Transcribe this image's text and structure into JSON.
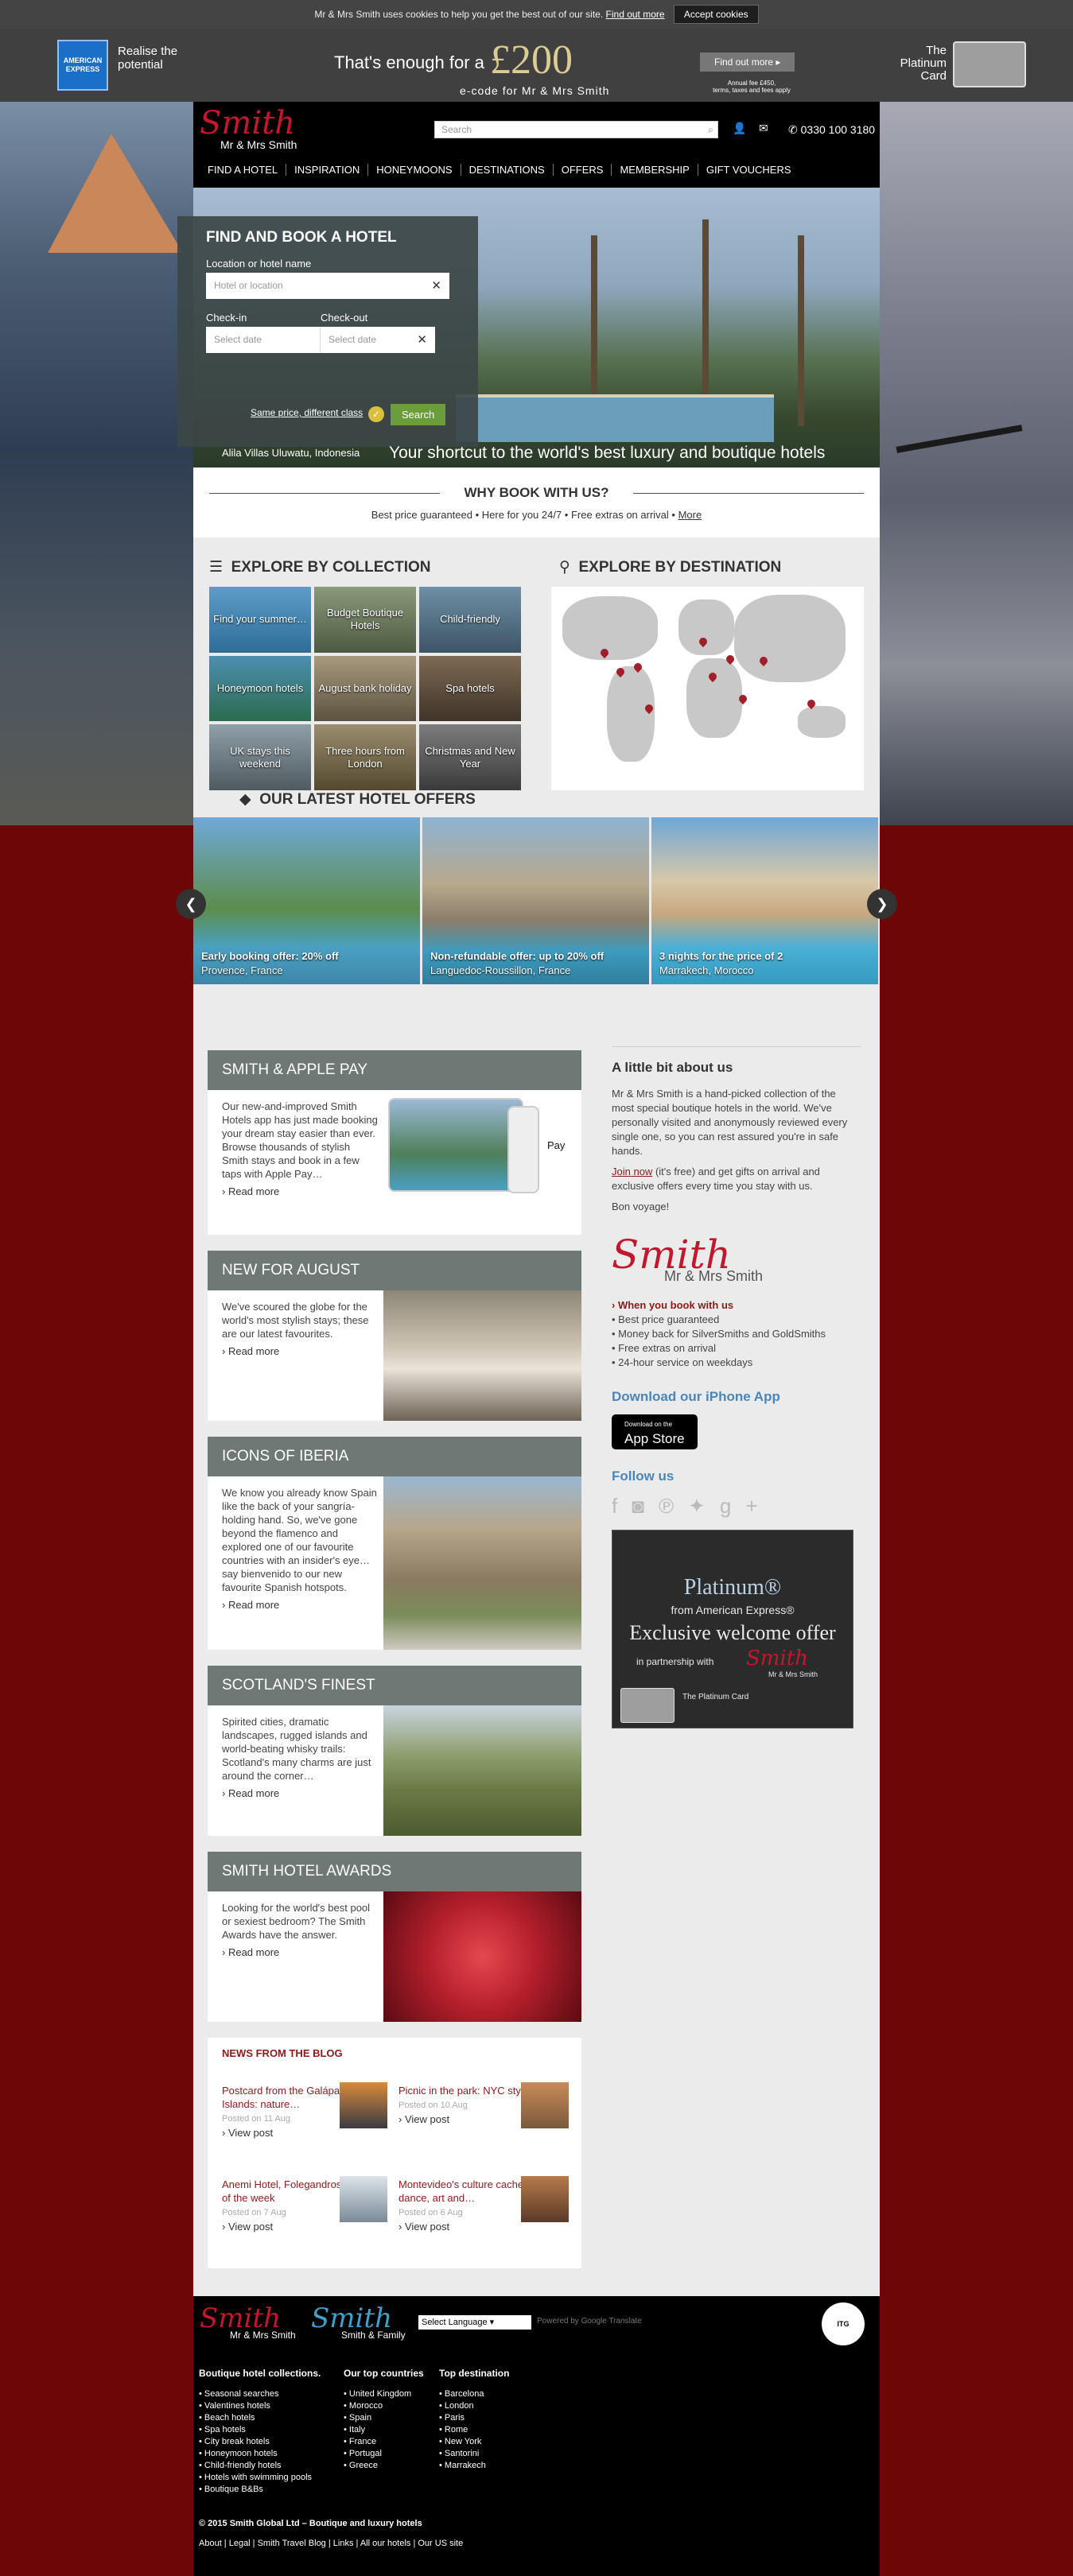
{
  "cookie": {
    "text": "Mr & Mrs Smith uses cookies to help you get the best out of our site.",
    "link": "Find out more",
    "button": "Accept cookies"
  },
  "ad": {
    "amex_logo": "AMERICAN EXPRESS",
    "amex_tag": "Realise the potential",
    "offer": "That's enough for a",
    "amount": "£200",
    "subline": "e-code for Mr & Mrs Smith",
    "find": "Find out more",
    "fine": "Annual fee &pound;450, terms, taxes and fees apply",
    "platinum": "The Platinum Card"
  },
  "header": {
    "logo_script": "Smith",
    "logo_name": "Mr & Mrs Smith",
    "search_placeholder": "Search",
    "search_icon": "search-icon",
    "phone": "0330 100 3180",
    "nav": [
      "FIND A HOTEL",
      "INSPIRATION",
      "HONEYMOONS",
      "DESTINATIONS",
      "OFFERS",
      "MEMBERSHIP",
      "GIFT VOUCHERS"
    ]
  },
  "booking": {
    "title": "FIND AND BOOK A HOTEL",
    "location_label": "Location or hotel name",
    "location_placeholder": "Hotel or location",
    "checkin_label": "Check-in",
    "checkout_label": "Check-out",
    "checkin_placeholder": "Select date",
    "checkout_placeholder": "Select date",
    "same_price": "Same price, different class",
    "search_btn": "Search"
  },
  "hero": {
    "caption": "Alila Villas Uluwatu, Indonesia",
    "tagline": "Your shortcut to the world's best luxury and boutique hotels"
  },
  "why": {
    "title": "WHY BOOK WITH US?",
    "text": "Best price guaranteed • Here for you 24/7 • Free extras on arrival •",
    "more": "More"
  },
  "collection": {
    "title": "EXPLORE BY COLLECTION",
    "tiles": [
      "Find your summer…",
      "Budget Boutique Hotels",
      "Child-friendly",
      "Honeymoon hotels",
      "August bank holiday",
      "Spa hotels",
      "UK stays this weekend",
      "Three hours from London",
      "Christmas and New Year"
    ]
  },
  "destination": {
    "title": "EXPLORE BY DESTINATION"
  },
  "offers": {
    "title": "OUR LATEST HOTEL OFFERS",
    "cards": [
      {
        "offer": "Early booking offer: 20% off",
        "place": "Provence, France"
      },
      {
        "offer": "Non-refundable offer: up to 20% off",
        "place": "Languedoc-Roussillon, France"
      },
      {
        "offer": "3 nights for the price of 2",
        "place": "Marrakech, Morocco"
      }
    ]
  },
  "features": [
    {
      "title": "SMITH & APPLE PAY",
      "text": "Our new-and-improved Smith Hotels app has just made booking your dream stay easier than ever. Browse thousands of stylish Smith stays and book in a few taps with Apple Pay…",
      "read": "Read more"
    },
    {
      "title": "NEW FOR AUGUST",
      "text": "We've scoured the globe for the world's most stylish stays; these are our latest favourites.",
      "read": "Read more"
    },
    {
      "title": "ICONS OF IBERIA",
      "text": "We know you already know Spain like the back of your sangría-holding hand. So, we've gone beyond the flamenco and explored one of our favourite countries with an insider's eye… say bienvenido to our new favourite Spanish hotspots.",
      "read": "Read more"
    },
    {
      "title": "SCOTLAND'S FINEST",
      "text": "Spirited cities, dramatic landscapes, rugged islands and world-beating whisky trails: Scotland's many charms are just around the corner…",
      "read": "Read more"
    },
    {
      "title": "SMITH HOTEL AWARDS",
      "text": "Looking for the world's best pool or sexiest bedroom? The Smith Awards have the answer.",
      "read": "Read more"
    }
  ],
  "blog": {
    "title": "NEWS FROM THE BLOG",
    "posts": [
      {
        "title": "Postcard from the Galápagos Islands: nature…",
        "date": "Posted on 11 Aug",
        "view": "View post"
      },
      {
        "title": "Picnic in the park: NYC style",
        "date": "Posted on 10 Aug",
        "view": "View post"
      },
      {
        "title": "Anemi Hotel, Folegandros: hotel of the week",
        "date": "Posted on 7 Aug",
        "view": "View post"
      },
      {
        "title": "Montevideo's culture cache: dance, art and…",
        "date": "Posted on 6 Aug",
        "view": "View post"
      }
    ]
  },
  "side": {
    "about_title": "A little bit about us",
    "about_text": "Mr & Mrs Smith is a hand-picked collection of the most special boutique hotels in the world. We've personally visited and anonymously reviewed every single one, so you can rest assured you're in safe hands.",
    "join_link": "Join now",
    "join_text": "(it's free) and get gifts on arrival and exclusive offers every time you stay with us.",
    "bon": "Bon voyage!",
    "logo_script": "Smith",
    "logo_name": "Mr & Mrs Smith",
    "benefits": [
      "When you book with us",
      "Best price guaranteed",
      "Money back for SilverSmiths and GoldSmiths",
      "Free extras on arrival",
      "24-hour service on weekdays"
    ],
    "app_title": "Download our iPhone App",
    "app_small": "Download on the",
    "app_big": "App Store",
    "follow": "Follow us",
    "social_icons": [
      "facebook-icon",
      "instagram-icon",
      "pinterest-icon",
      "twitter-icon",
      "googleplus-icon"
    ]
  },
  "platad": {
    "t1": "Platinum®",
    "t2": "from American Express®",
    "t3": "Exclusive welcome offer",
    "t4": "in partnership with",
    "script": "Smith",
    "mrs": "Mr & Mrs Smith",
    "card_text": "The Platinum Card"
  },
  "footer": {
    "logo1_script": "Smith",
    "logo1_name": "Mr & Mrs Smith",
    "logo2_script": "Smith",
    "logo2_name": "Smith & Family",
    "language": "Select Language",
    "powered": "Powered by Google Translate",
    "badge": "ITG",
    "col1_title": "Boutique hotel collections.",
    "col1": [
      "Seasonal searches",
      "Valentines hotels",
      "Beach hotels",
      "Spa hotels",
      "City break hotels",
      "Honeymoon hotels",
      "Child-friendly hotels",
      "Hotels with swimming pools",
      "Boutique B&Bs"
    ],
    "col2_title": "Our top countries",
    "col2": [
      "United Kingdom",
      "Morocco",
      "Spain",
      "Italy",
      "France",
      "Portugal",
      "Greece"
    ],
    "col3_title": "Top destination",
    "col3": [
      "Barcelona",
      "London",
      "Paris",
      "Rome",
      "New York",
      "Santorini",
      "Marrakech"
    ],
    "copyright": "© 2015 Smith Global Ltd – Boutique and luxury hotels",
    "links": "About | Legal | Smith Travel Blog | Links | All our hotels | Our US site"
  }
}
